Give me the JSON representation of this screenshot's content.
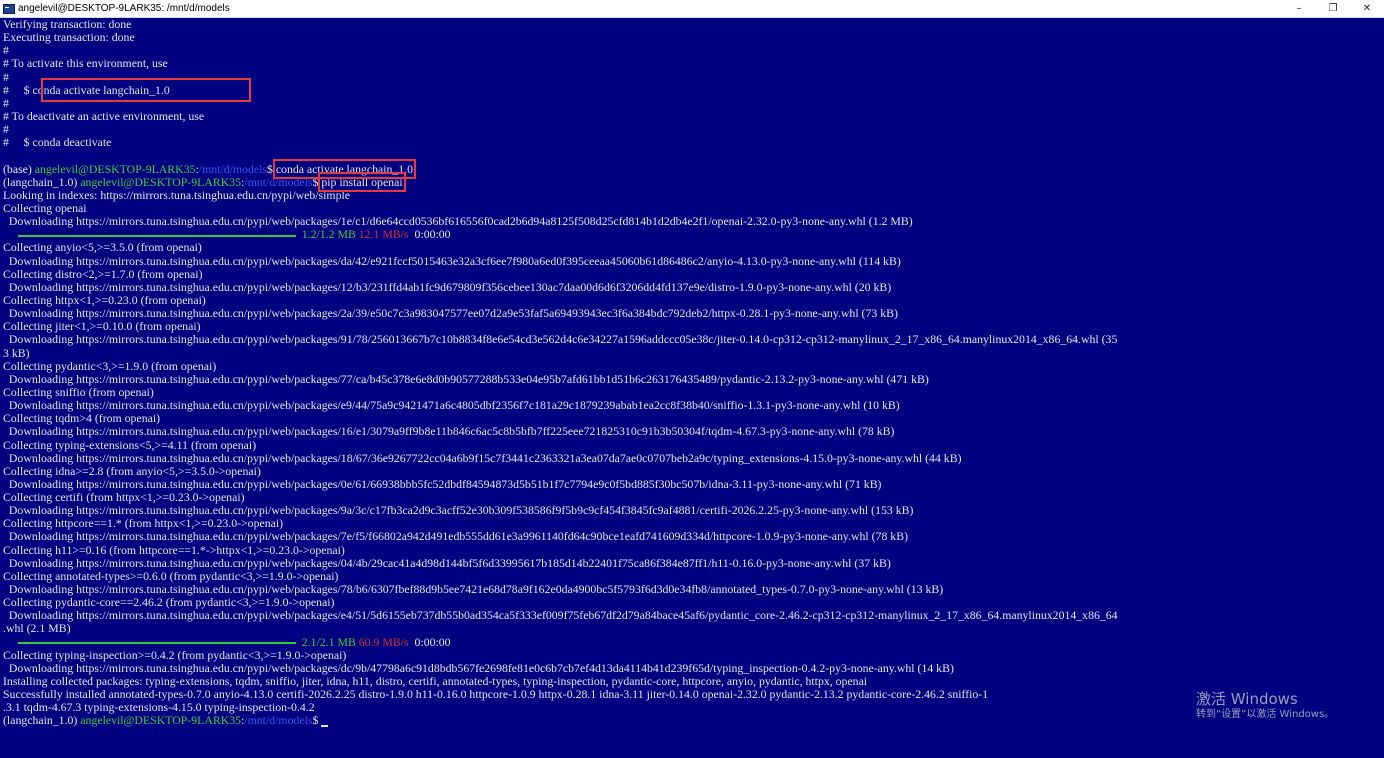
{
  "window": {
    "title": "angelevil@DESKTOP-9LARK35: /mnt/d/models",
    "minimize_glyph": "–",
    "maximize_glyph": "❐",
    "close_glyph": "✕"
  },
  "colors": {
    "background": "#000080",
    "text": "#e6e6e6",
    "prompt_user": "#3bd13b",
    "prompt_path": "#3355ee",
    "highlight": "#e8383d",
    "progress": "#2ecc40"
  },
  "terminal": {
    "lines": [
      "Verifying transaction: done",
      "Executing transaction: done",
      "#",
      "# To activate this environment, use",
      "#",
      "#     $ conda activate langchain_1.0",
      "#",
      "# To deactivate an active environment, use",
      "#",
      "#     $ conda deactivate",
      "",
      "PROMPT1",
      "PROMPT2",
      "Looking in indexes: https://mirrors.tuna.tsinghua.edu.cn/pypi/web/simple",
      "Collecting openai",
      "  Downloading https://mirrors.tuna.tsinghua.edu.cn/pypi/web/packages/1e/c1/d6e64ccd0536bf616556f0cad2b6d94a8125f508d25cfd814b1d2db4e2f1/openai-2.32.0-py3-none-any.whl (1.2 MB)",
      "PROGRESS1",
      "Collecting anyio<5,>=3.5.0 (from openai)",
      "  Downloading https://mirrors.tuna.tsinghua.edu.cn/pypi/web/packages/da/42/e921fccf5015463e32a3cf6ee7f980a6ed0f395ceeaa45060b61d86486c2/anyio-4.13.0-py3-none-any.whl (114 kB)",
      "Collecting distro<2,>=1.7.0 (from openai)",
      "  Downloading https://mirrors.tuna.tsinghua.edu.cn/pypi/web/packages/12/b3/231ffd4ab1fc9d679809f356cebee130ac7daa00d6d6f3206dd4fd137e9e/distro-1.9.0-py3-none-any.whl (20 kB)",
      "Collecting httpx<1,>=0.23.0 (from openai)",
      "  Downloading https://mirrors.tuna.tsinghua.edu.cn/pypi/web/packages/2a/39/e50c7c3a983047577ee07d2a9e53faf5a69493943ec3f6a384bdc792deb2/httpx-0.28.1-py3-none-any.whl (73 kB)",
      "Collecting jiter<1,>=0.10.0 (from openai)",
      "  Downloading https://mirrors.tuna.tsinghua.edu.cn/pypi/web/packages/91/78/256013667b7c10b8834f8e6e54cd3e562d4c6e34227a1596addccc05e38c/jiter-0.14.0-cp312-cp312-manylinux_2_17_x86_64.manylinux2014_x86_64.whl (35",
      "3 kB)",
      "Collecting pydantic<3,>=1.9.0 (from openai)",
      "  Downloading https://mirrors.tuna.tsinghua.edu.cn/pypi/web/packages/77/ca/b45c378e6e8d0b90577288b533e04e95b7afd61bb1d51b6c263176435489/pydantic-2.13.2-py3-none-any.whl (471 kB)",
      "Collecting sniffio (from openai)",
      "  Downloading https://mirrors.tuna.tsinghua.edu.cn/pypi/web/packages/e9/44/75a9c9421471a6c4805dbf2356f7c181a29c1879239abab1ea2cc8f38b40/sniffio-1.3.1-py3-none-any.whl (10 kB)",
      "Collecting tqdm>4 (from openai)",
      "  Downloading https://mirrors.tuna.tsinghua.edu.cn/pypi/web/packages/16/e1/3079a9ff9b8e11b846c6ac5c8b5bfb7ff225eee721825310c91b3b50304f/tqdm-4.67.3-py3-none-any.whl (78 kB)",
      "Collecting typing-extensions<5,>=4.11 (from openai)",
      "  Downloading https://mirrors.tuna.tsinghua.edu.cn/pypi/web/packages/18/67/36e9267722cc04a6b9f15c7f3441c2363321a3ea07da7ae0c0707beb2a9c/typing_extensions-4.15.0-py3-none-any.whl (44 kB)",
      "Collecting idna>=2.8 (from anyio<5,>=3.5.0->openai)",
      "  Downloading https://mirrors.tuna.tsinghua.edu.cn/pypi/web/packages/0e/61/66938bbb5fc52dbdf84594873d5b51b1f7c7794e9c0f5bd885f30bc507b/idna-3.11-py3-none-any.whl (71 kB)",
      "Collecting certifi (from httpx<1,>=0.23.0->openai)",
      "  Downloading https://mirrors.tuna.tsinghua.edu.cn/pypi/web/packages/9a/3c/c17fb3ca2d9c3acff52e30b309f538586f9f5b9c9cf454f3845fc9af4881/certifi-2026.2.25-py3-none-any.whl (153 kB)",
      "Collecting httpcore==1.* (from httpx<1,>=0.23.0->openai)",
      "  Downloading https://mirrors.tuna.tsinghua.edu.cn/pypi/web/packages/7e/f5/f66802a942d491edb555dd61e3a9961140fd64c90bce1eafd741609d334d/httpcore-1.0.9-py3-none-any.whl (78 kB)",
      "Collecting h11>=0.16 (from httpcore==1.*->httpx<1,>=0.23.0->openai)",
      "  Downloading https://mirrors.tuna.tsinghua.edu.cn/pypi/web/packages/04/4b/29cac41a4d98d144bf5f6d33995617b185d14b22401f75ca86f384e87ff1/h11-0.16.0-py3-none-any.whl (37 kB)",
      "Collecting annotated-types>=0.6.0 (from pydantic<3,>=1.9.0->openai)",
      "  Downloading https://mirrors.tuna.tsinghua.edu.cn/pypi/web/packages/78/b6/6307fbef88d9b5ee7421e68d78a9f162e0da4900bc5f5793f6d3d0e34fb8/annotated_types-0.7.0-py3-none-any.whl (13 kB)",
      "Collecting pydantic-core==2.46.2 (from pydantic<3,>=1.9.0->openai)",
      "  Downloading https://mirrors.tuna.tsinghua.edu.cn/pypi/web/packages/e4/51/5d6155eb737db55b0ad354ca5f333ef009f75feb67df2d79a84bace45af6/pydantic_core-2.46.2-cp312-cp312-manylinux_2_17_x86_64.manylinux2014_x86_64",
      ".whl (2.1 MB)",
      "PROGRESS2",
      "Collecting typing-inspection>=0.4.2 (from pydantic<3,>=1.9.0->openai)",
      "  Downloading https://mirrors.tuna.tsinghua.edu.cn/pypi/web/packages/dc/9b/47798a6c91d8bdb567fe2698fe81e0c6b7cb7ef4d13da4114b41d239f65d/typing_inspection-0.4.2-py3-none-any.whl (14 kB)",
      "Installing collected packages: typing-extensions, tqdm, sniffio, jiter, idna, h11, distro, certifi, annotated-types, typing-inspection, pydantic-core, httpcore, anyio, pydantic, httpx, openai",
      "Successfully installed annotated-types-0.7.0 anyio-4.13.0 certifi-2026.2.25 distro-1.9.0 h11-0.16.0 httpcore-1.0.9 httpx-0.28.1 idna-3.11 jiter-0.14.0 openai-2.32.0 pydantic-2.13.2 pydantic-core-2.46.2 sniffio-1",
      ".3.1 tqdm-4.67.3 typing-extensions-4.15.0 typing-inspection-0.4.2",
      "PROMPT3"
    ],
    "prompt1": {
      "env": "(base) ",
      "user": "angelevil@DESKTOP-9LARK35",
      "sep": ":",
      "path": "/mnt/d/models",
      "dollar": "$ ",
      "command": "conda activate langchain_1.0"
    },
    "prompt2": {
      "env": "(langchain_1.0) ",
      "user": "angelevil@DESKTOP-9LARK35",
      "sep": ":",
      "path": "/mnt/d/models",
      "dollar": "$ ",
      "command": "pip install openai"
    },
    "prompt3": {
      "env": "(langchain_1.0) ",
      "user": "angelevil@DESKTOP-9LARK35",
      "sep": ":",
      "path": "/mnt/d/models",
      "dollar": "$ "
    },
    "progress1": {
      "fraction": 1.0,
      "size": "1.2/1.2 MB",
      "speed": "12.1 MB/s",
      "eta": "0:00:00"
    },
    "progress2": {
      "fraction": 1.0,
      "size": "2.1/2.1 MB",
      "speed": "60.9 MB/s",
      "eta": "0:00:00"
    }
  },
  "watermark": {
    "line1": "激活 Windows",
    "line2": "转到“设置”以激活 Windows。"
  }
}
